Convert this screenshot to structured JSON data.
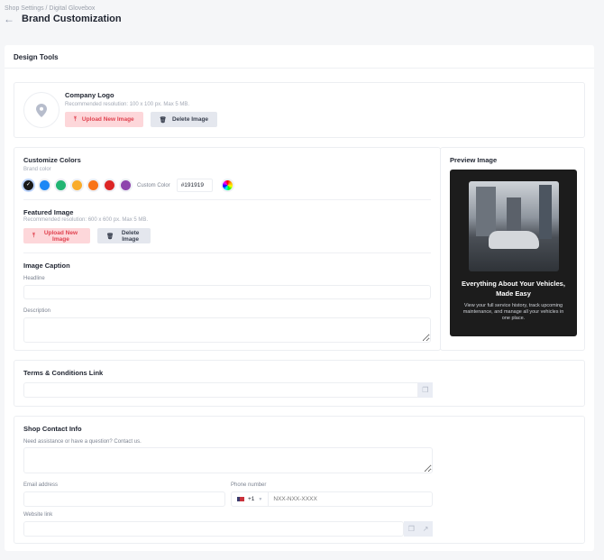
{
  "header": {
    "breadcrumb": "Shop Settings / Digital Glovebox",
    "title": "Brand Customization"
  },
  "main": {
    "title": "Design Tools"
  },
  "logo": {
    "title": "Company Logo",
    "hint": "Recommended resolution: 100 x 100 px. Max 5 MB.",
    "upload": "Upload New Image",
    "delete": "Delete Image"
  },
  "colors": {
    "title": "Customize Colors",
    "sub": "Brand color",
    "swatches": [
      "#191919",
      "#1e88f5",
      "#22b573",
      "#f9ac2c",
      "#f97316",
      "#dc2626",
      "#8e44ad"
    ],
    "custom_label": "Custom Color",
    "custom_value": "#191919"
  },
  "featured": {
    "title": "Featured Image",
    "hint": "Recommended resolution: 600 x 600 px. Max 5 MB.",
    "upload": "Upload New Image",
    "delete": "Delete Image"
  },
  "caption": {
    "title": "Image Caption",
    "headline": "Headline",
    "description": "Description"
  },
  "preview": {
    "title": "Preview Image",
    "heading": "Everything About Your Vehicles, Made Easy",
    "body": "View your full service history, track upcoming maintenance, and manage all your vehicles in one place."
  },
  "terms": {
    "title": "Terms & Conditions Link"
  },
  "contact": {
    "title": "Shop Contact Info",
    "message_label": "Need assistance or have a question? Contact us.",
    "email_label": "Email address",
    "phone_label": "Phone number",
    "country_code": "+1",
    "phone_placeholder": "NXX-NXX-XXXX",
    "website_label": "Website link"
  }
}
